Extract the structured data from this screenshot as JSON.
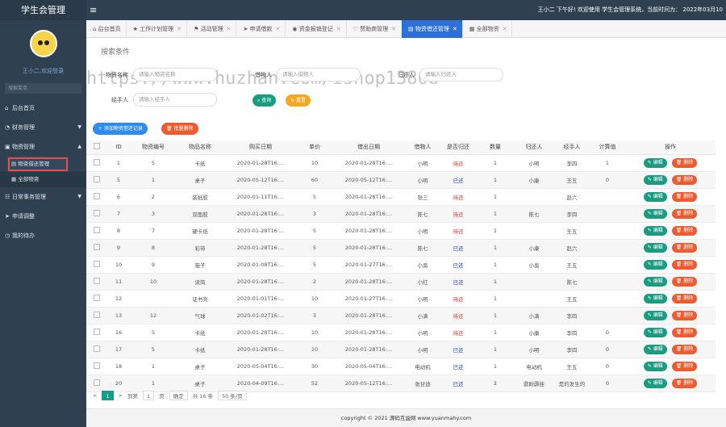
{
  "app": {
    "title": "学生会管理",
    "top_info": "王小二 下午好!  欢迎使用 学生会管理系统，当前时间为： 2022年03月10"
  },
  "user": {
    "welcome": "王小二,欢迎登录"
  },
  "sidebar": {
    "search_placeholder": "搜索菜单",
    "items": [
      {
        "label": "后台首页",
        "icon": "home-icon"
      },
      {
        "label": "财务管理",
        "icon": "finance-icon"
      },
      {
        "label": "物资管理",
        "icon": "box-icon"
      },
      {
        "label": "日常事务管理",
        "icon": "calendar-icon"
      },
      {
        "label": "申请调整",
        "icon": "send-icon"
      },
      {
        "label": "我的待办",
        "icon": "todo-icon"
      }
    ],
    "subitems": [
      {
        "label": "物资借还管理"
      },
      {
        "label": "全部物资"
      }
    ]
  },
  "tabs": [
    {
      "label": "后台首页",
      "icon": "home-icon"
    },
    {
      "label": "工作计划管理",
      "icon": "star-icon"
    },
    {
      "label": "活动管理",
      "icon": "flag-icon"
    },
    {
      "label": "申请借款",
      "icon": "send-icon"
    },
    {
      "label": "资金报销登记",
      "icon": "coin-icon"
    },
    {
      "label": "赞助商管理",
      "icon": "sponsor-icon"
    },
    {
      "label": "物资借还管理",
      "icon": "list-icon"
    },
    {
      "label": "全部物资",
      "icon": "grid-icon"
    }
  ],
  "search": {
    "title": "搜索条件",
    "watermark": "https://www.huzhan.com/ishop13808",
    "fields": [
      {
        "label": "物资名称",
        "placeholder": "请输入物资名称"
      },
      {
        "label": "借物人",
        "placeholder": "请输入借物人"
      },
      {
        "label": "归还人",
        "placeholder": "请输入归还人"
      },
      {
        "label": "经手人",
        "placeholder": "请输入经手人"
      }
    ],
    "search_btn": "查询",
    "reset_btn": "重置",
    "add_btn": "添加物资借还记录",
    "batch_delete_btn": "批量删除"
  },
  "table": {
    "headers": [
      "",
      "ID",
      "物资编号",
      "物品名称",
      "购买日期",
      "单价",
      "借出日期",
      "借物人",
      "是否归还",
      "数量",
      "归还人",
      "经手人",
      "计算值",
      "操作"
    ],
    "edit_label": "编辑",
    "delete_label": "删除",
    "rows": [
      [
        "1",
        "5",
        "卡纸",
        "2020-01-28T16:...",
        "10",
        "2020-01-28T16:...",
        "小明",
        "待还",
        "1",
        "小明",
        "李四",
        "1"
      ],
      [
        "5",
        "1",
        "桌子",
        "2020-05-12T16:...",
        "60",
        "2020-05-12T16:...",
        "小明",
        "已还",
        "1",
        "小康",
        "王五",
        "0"
      ],
      [
        "6",
        "2",
        "装纸胶",
        "2020-01-11T16:...",
        "5",
        "2020-01-28T16:...",
        "张三",
        "待还",
        "1",
        "",
        "赵六",
        ""
      ],
      [
        "7",
        "3",
        "双面胶",
        "2020-01-28T16:...",
        "3",
        "2020-01-28T16:...",
        "陈七",
        "待还",
        "1",
        "陈七",
        "李四",
        ""
      ],
      [
        "8",
        "7",
        "硬卡纸",
        "2020-01-28T16:...",
        "5",
        "2020-01-28T16:...",
        "小明",
        "待还",
        "1",
        "",
        "王五",
        ""
      ],
      [
        "9",
        "8",
        "彩带",
        "2020-01-28T16:...",
        "5",
        "2020-01-28T16:...",
        "陈七",
        "已还",
        "1",
        "小康",
        "赵六",
        ""
      ],
      [
        "10",
        "9",
        "猫子",
        "2020-01-08T16:...",
        "5",
        "2020-01-27T16:...",
        "小吳",
        "已还",
        "1",
        "小吳",
        "王五",
        ""
      ],
      [
        "11",
        "10",
        "读简",
        "2020-01-28T16:...",
        "2",
        "2020-01-28T16:...",
        "小红",
        "已还",
        "1",
        "",
        "陈七",
        ""
      ],
      [
        "12",
        "",
        "证书壳",
        "2020-01-01T16:...",
        "10",
        "2020-01-27T16:...",
        "小明",
        "待还",
        "1",
        "",
        "王五",
        ""
      ],
      [
        "13",
        "12",
        "气球",
        "2020-01-02T16:...",
        "3",
        "2020-01-28T16:...",
        "小满",
        "待还",
        "1",
        "小满",
        "李四",
        ""
      ],
      [
        "16",
        "5",
        "卡纸",
        "2020-01-28T16:...",
        "10",
        "2020-01-28T16:...",
        "小明",
        "待还",
        "1",
        "小康",
        "李四",
        "0"
      ],
      [
        "17",
        "5",
        "卡纸",
        "2020-01-28T16:...",
        "10",
        "2020-01-28T16:...",
        "小明",
        "已还",
        "1",
        "小明",
        "李四",
        "0"
      ],
      [
        "18",
        "1",
        "桌子",
        "2020-05-04T16:...",
        "30",
        "2020-05-04T16:...",
        "电动机",
        "已还",
        "1",
        "电动机",
        "王五",
        "0"
      ],
      [
        "20",
        "1",
        "桌子",
        "2020-04-09T16:...",
        "52",
        "2020-05-12T16:...",
        "张甘迪",
        "已还",
        "2",
        "鼎盼霹挂",
        "是的发生的",
        "0"
      ]
    ]
  },
  "pager": {
    "prev": "<",
    "current": "1",
    "next": ">",
    "goto_label": "到第",
    "goto_value": "1",
    "page_unit": "页",
    "confirm": "确定",
    "total": "共 16 条",
    "page_size": "50 条/页"
  },
  "footer": {
    "text": "copyright © 2021 源码互益网  www.yuanmahy.com"
  },
  "colors": {
    "sidebar": "#2f4050",
    "active_tab": "#2c6fd6",
    "green": "#1a9c83",
    "orange": "#ef5b2e",
    "pending": "#e23b3b",
    "returned": "#2646c8"
  }
}
